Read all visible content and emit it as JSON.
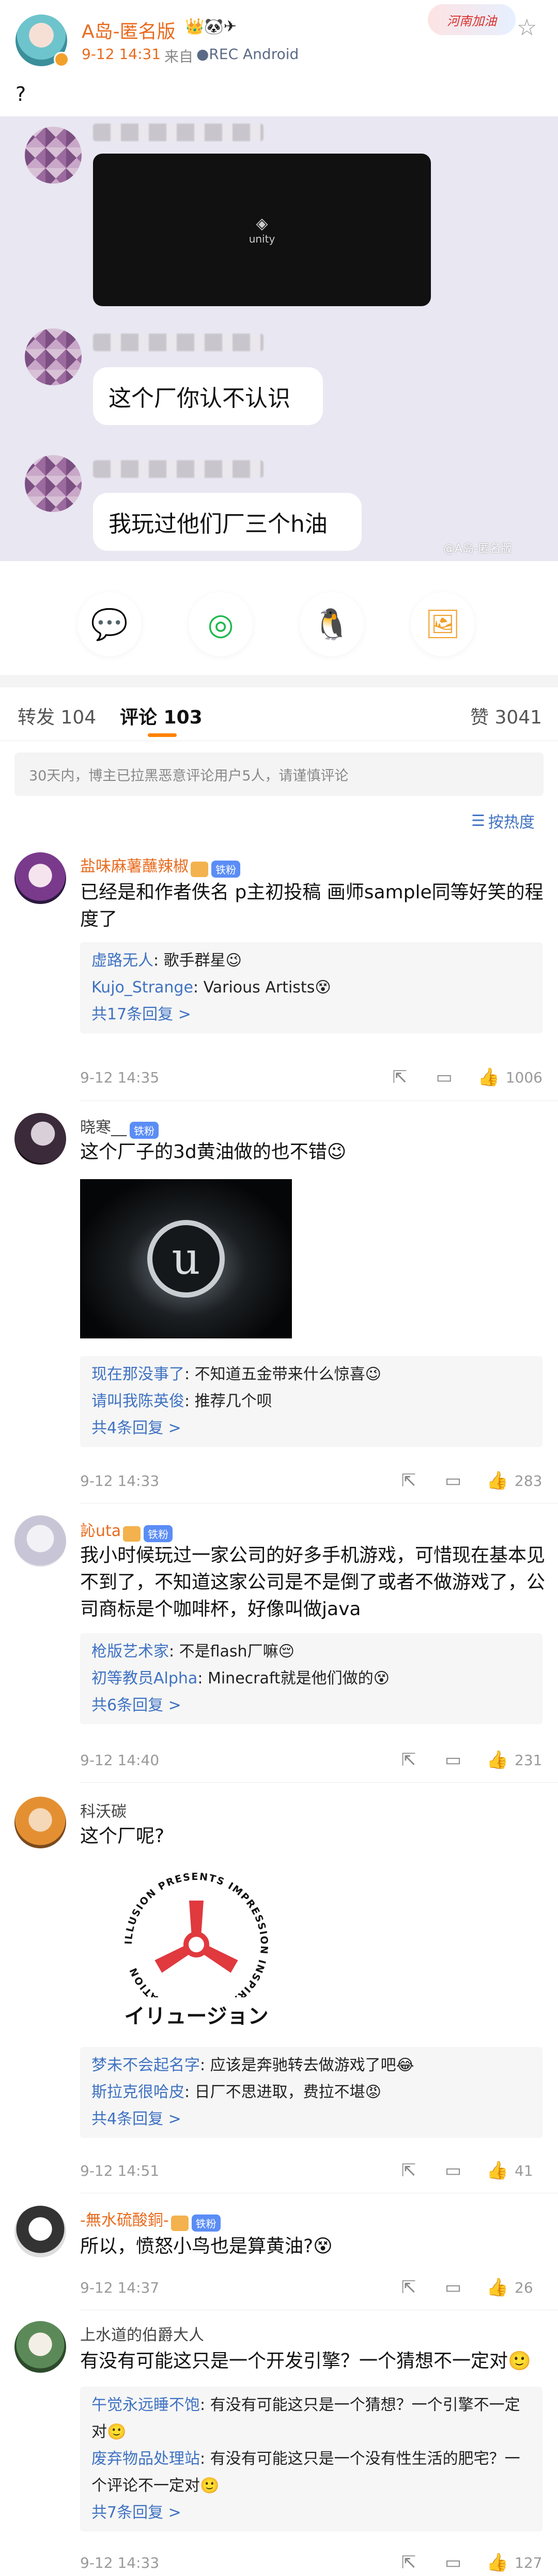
{
  "post": {
    "author": "A岛-匿名版",
    "time": "9-12 14:31",
    "source_prefix": "来自",
    "source": "●REC Android",
    "body": "?",
    "decoration_text": "河南加油",
    "watermark": "@A岛-匿名版",
    "unity_logo_text": "unity",
    "chat": [
      {
        "text": ""
      },
      {
        "text": "这个厂你认不认识"
      },
      {
        "text": "我玩过他们厂三个h油"
      }
    ]
  },
  "share_buttons": [
    "wechat-icon",
    "moments-icon",
    "qq-icon",
    "save-image-icon"
  ],
  "tabs": {
    "repost": "转发 104",
    "comments": "评论 103",
    "likes": "赞 3041"
  },
  "notice": "30天内，博主已拉黑恶意评论用户5人，请谨慎评论",
  "sort_label": "按热度",
  "badge_fans": "铁粉",
  "comments": [
    {
      "name": "盐味麻薯蘸辣椒",
      "badge": true,
      "text": "已经是和作者佚名 p主初投稿 画师sample同等好笑的程度了",
      "replies": [
        {
          "name": "虚路无人",
          "text": ": 歌手群星😉"
        },
        {
          "name": "Kujo_Strange",
          "text": ": Various Artists😵"
        }
      ],
      "more": "共17条回复 >",
      "time": "9-12 14:35",
      "likes": "1006"
    },
    {
      "name": "晓寒__",
      "badge": true,
      "text": "这个厂子的3d黄油做的也不错😉",
      "image_caption": "",
      "replies": [
        {
          "name": "现在那没事了",
          "text": ": 不知道五金带来什么惊喜😉"
        },
        {
          "name": "请叫我陈英俊",
          "text": ": 推荐几个呗"
        }
      ],
      "more": "共4条回复 >",
      "time": "9-12 14:33",
      "likes": "283"
    },
    {
      "name": "訫uta",
      "badge": true,
      "text": "我小时候玩过一家公司的好多手机游戏，可惜现在基本见不到了，不知道这家公司是不是倒了或者不做游戏了，公司商标是个咖啡杯，好像叫做java",
      "replies": [
        {
          "name": "枪版艺术家",
          "text": ": 不是flash厂嘛😔"
        },
        {
          "name": "初等教员Alpha",
          "text": ": Minecraft就是他们做的😵"
        }
      ],
      "more": "共6条回复 >",
      "time": "9-12 14:40",
      "likes": "231"
    },
    {
      "name": "科沃碳",
      "badge": false,
      "text": "这个厂呢?",
      "logo_text": "イリュージョン",
      "logo_ring_text": "ILLUSION PRESENTS IMPRESSION INSPIRATION INNOVATION",
      "replies": [
        {
          "name": "梦未不会起名字",
          "text": ": 应该是奔驰转去做游戏了吧😂"
        },
        {
          "name": "斯拉克很哈皮",
          "text": ": 日厂不思进取，费拉不堪😡"
        }
      ],
      "more": "共4条回复 >",
      "time": "9-12 14:51",
      "likes": "41"
    },
    {
      "name": "-無水硫酸銅-",
      "badge": true,
      "text": "所以，愤怒小鸟也是算黄油?😵",
      "replies": [],
      "more": "",
      "time": "9-12 14:37",
      "likes": "26"
    },
    {
      "name": "上水道的伯爵大人",
      "badge": false,
      "text": "有没有可能这只是一个开发引擎？一个猜想不一定对🙂",
      "replies": [
        {
          "name": "午觉永远睡不饱",
          "text": ": 有没有可能这只是一个猜想？一个引擎不一定对🙂"
        },
        {
          "name": "废弃物品处理站",
          "text": ": 有没有可能这只是一个没有性生活的肥宅？一个评论不一定对🙂"
        }
      ],
      "more": "共7条回复 >",
      "time": "9-12 14:33",
      "likes": "127"
    }
  ],
  "colors": {
    "accent_orange": "#e86b1e",
    "link_blue": "#3f72c2",
    "badge_blue": "#5b8df6",
    "post_bg": "#e8e7f2"
  }
}
